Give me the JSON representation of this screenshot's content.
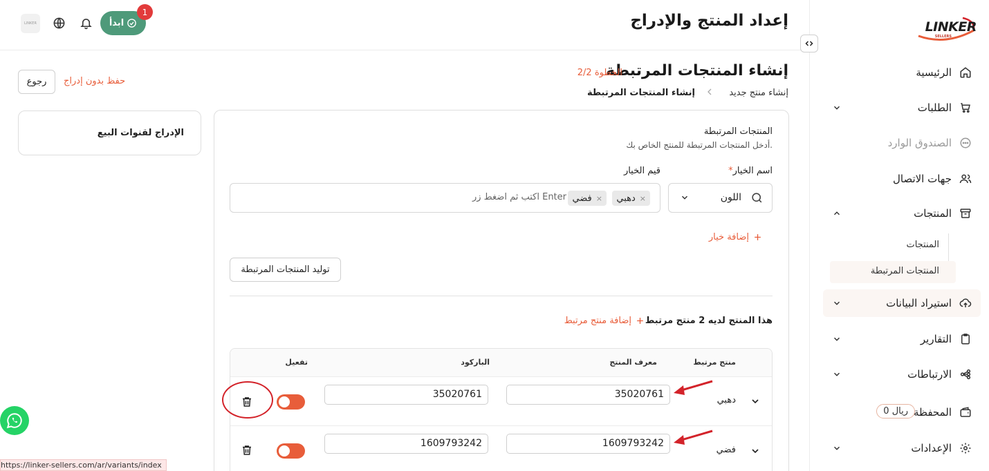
{
  "app": {
    "brand": "LINKER",
    "brand_sub": "SELLERS",
    "page_heading": "إعداد المنتج والإدراج"
  },
  "topbar": {
    "start_label": "ابدأ",
    "notification_count": "1",
    "avatar_text": "LINKER"
  },
  "sidebar": {
    "items": [
      {
        "label": "الرئيسية",
        "icon": "home-icon"
      },
      {
        "label": "الطلبات",
        "icon": "cart-icon"
      },
      {
        "label": "الصندوق الوارد",
        "icon": "chat-icon"
      },
      {
        "label": "جهات الاتصال",
        "icon": "users-icon"
      },
      {
        "label": "المنتجات",
        "icon": "archive-icon"
      },
      {
        "label": "استيراد البيانات",
        "icon": "upload-cloud-icon"
      },
      {
        "label": "التقارير",
        "icon": "clipboard-icon"
      },
      {
        "label": "الارتباطات",
        "icon": "share-icon"
      },
      {
        "label": "المحفظة",
        "icon": "wallet-icon"
      },
      {
        "label": "الإعدادات",
        "icon": "gear-icon"
      }
    ],
    "products_sub": [
      "المنتجات",
      "المنتجات المرتبطة"
    ],
    "wallet_balance": "0 ريال"
  },
  "header": {
    "title": "إنشاء المنتجات المرتبطة",
    "step": "الخطوة 2/2",
    "breadcrumb": [
      "إنشاء منتج جديد",
      "إنشاء المنتجات المرتبطة"
    ],
    "back_label": "رجوع",
    "save_label": "حفظ بدون إدراج"
  },
  "side_card": {
    "title": "الإدراج لقنوات البيع"
  },
  "variants_section": {
    "title": "المنتجات المرتبطة",
    "description": "أدخل المنتجات المرتبطة للمنتج الخاص بك.",
    "option_name_label": "اسم الخيار",
    "option_values_label": "قيم الخيار",
    "option_name_value": "اللون",
    "tags": [
      "دهبي",
      "فضي"
    ],
    "tag_placeholder": "اكتب ثم اضغط زر Enter",
    "add_option_label": "إضافة خيار",
    "generate_label": "توليد المنتجات المرتبطة",
    "count_text": "هذا المنتج لديه 2 منتج مرتبط",
    "add_variant_label": "إضافة منتج مرتبط"
  },
  "table": {
    "headers": [
      "منتج مرتبط",
      "معرف المنتج",
      "الباركود",
      "تفعيل"
    ],
    "rows": [
      {
        "name": "دهبي",
        "product_id": "35020761",
        "barcode": "35020761",
        "active": true
      },
      {
        "name": "فضي",
        "product_id": "1609793242",
        "barcode": "1609793242",
        "active": true
      }
    ]
  },
  "statusbar": {
    "url": "https://linker-sellers.com/ar/variants/index"
  },
  "colors": {
    "accent": "#e85d3a",
    "green": "#4e9a7a",
    "annotation_red": "#d3232a"
  }
}
